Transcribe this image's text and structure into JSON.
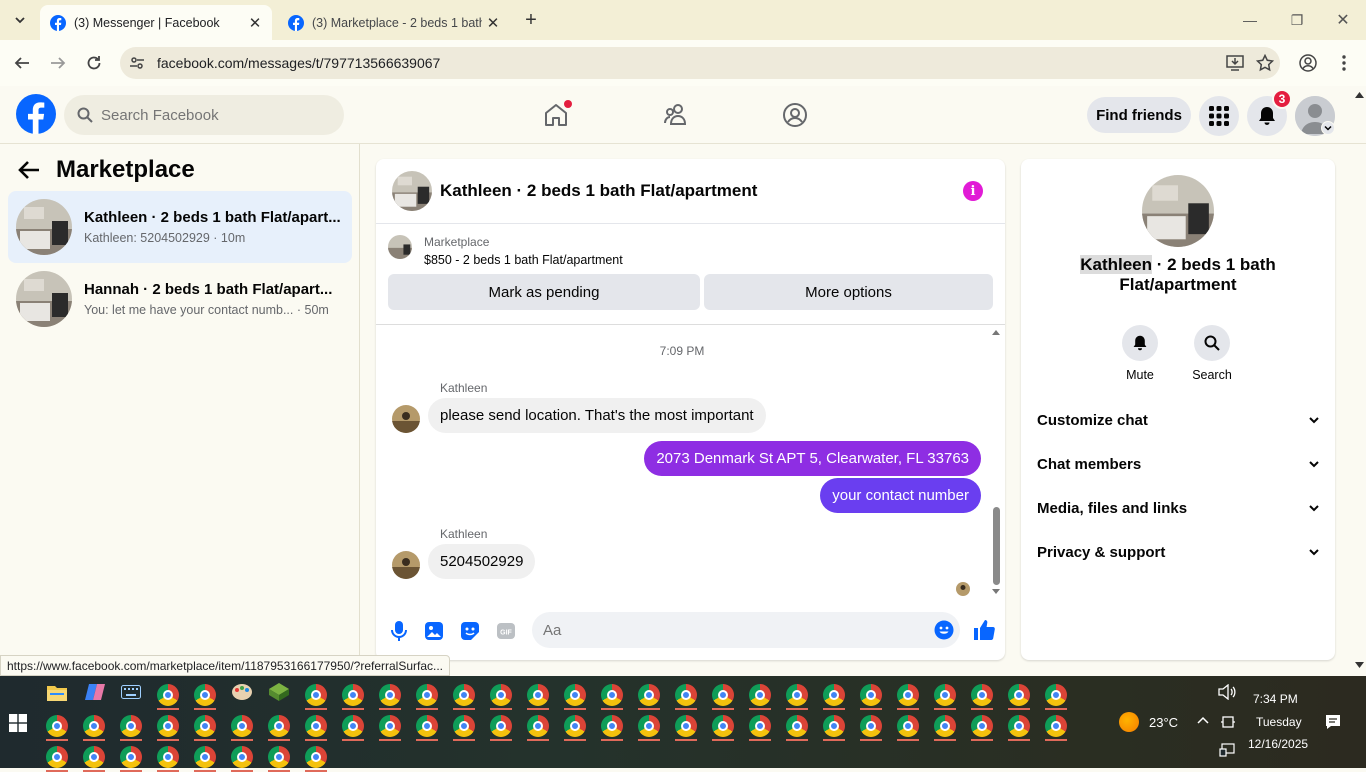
{
  "browser": {
    "tabs": [
      {
        "title": "(3) Messenger | Facebook",
        "active": true
      },
      {
        "title": "(3) Marketplace - 2 beds 1 bath",
        "active": false
      }
    ],
    "url": "facebook.com/messages/t/797713566639067",
    "status_url": "https://www.facebook.com/marketplace/item/1187953166177950/?referralSurfac..."
  },
  "facebook": {
    "search_placeholder": "Search Facebook",
    "find_friends": "Find friends",
    "notification_count": "3"
  },
  "sidebar": {
    "title": "Marketplace",
    "conversations": [
      {
        "title": "Kathleen · 2 beds 1 bath Flat/apart...",
        "subtitle": "Kathleen: 5204502929 · 10m",
        "selected": true
      },
      {
        "title": "Hannah · 2 beds 1 bath Flat/apart...",
        "subtitle": "You: let me have your contact numb... · 50m",
        "selected": false
      }
    ]
  },
  "chat": {
    "title": "Kathleen · 2 beds 1 bath Flat/apartment",
    "marketplace_label": "Marketplace",
    "listing": "$850 - 2 beds 1 bath Flat/apartment",
    "mark_pending": "Mark as pending",
    "more_options": "More options",
    "timestamp": "7:09 PM",
    "messages": [
      {
        "sender": "Kathleen",
        "text": "please send location. That's the most important",
        "outgoing": false
      },
      {
        "text": "2073 Denmark St APT 5, Clearwater, FL 33763",
        "outgoing": true,
        "color": "#8e2ee3"
      },
      {
        "text": "your contact number",
        "outgoing": true,
        "color": "#6a3ef0"
      },
      {
        "sender": "Kathleen",
        "text": "5204502929",
        "outgoing": false
      }
    ],
    "composer_placeholder": "Aa"
  },
  "details": {
    "title_name": "Kathleen",
    "title_rest": " · 2 beds 1 bath",
    "title_line2": "Flat/apartment",
    "actions": [
      {
        "label": "Mute",
        "icon": "bell-icon"
      },
      {
        "label": "Search",
        "icon": "search-icon"
      }
    ],
    "sections": [
      "Customize chat",
      "Chat members",
      "Media, files and links",
      "Privacy & support"
    ]
  },
  "taskbar": {
    "weather": "23°C",
    "time": "7:34 PM",
    "day": "Tuesday",
    "date": "12/16/2025"
  },
  "colors": {
    "messenger_purple": "#8e2ee3",
    "messenger_blue_purple": "#6a3ef0",
    "fb_blue": "#0866ff",
    "info_magenta": "#e11bd6",
    "selected_conv": "#e7f0fb"
  }
}
